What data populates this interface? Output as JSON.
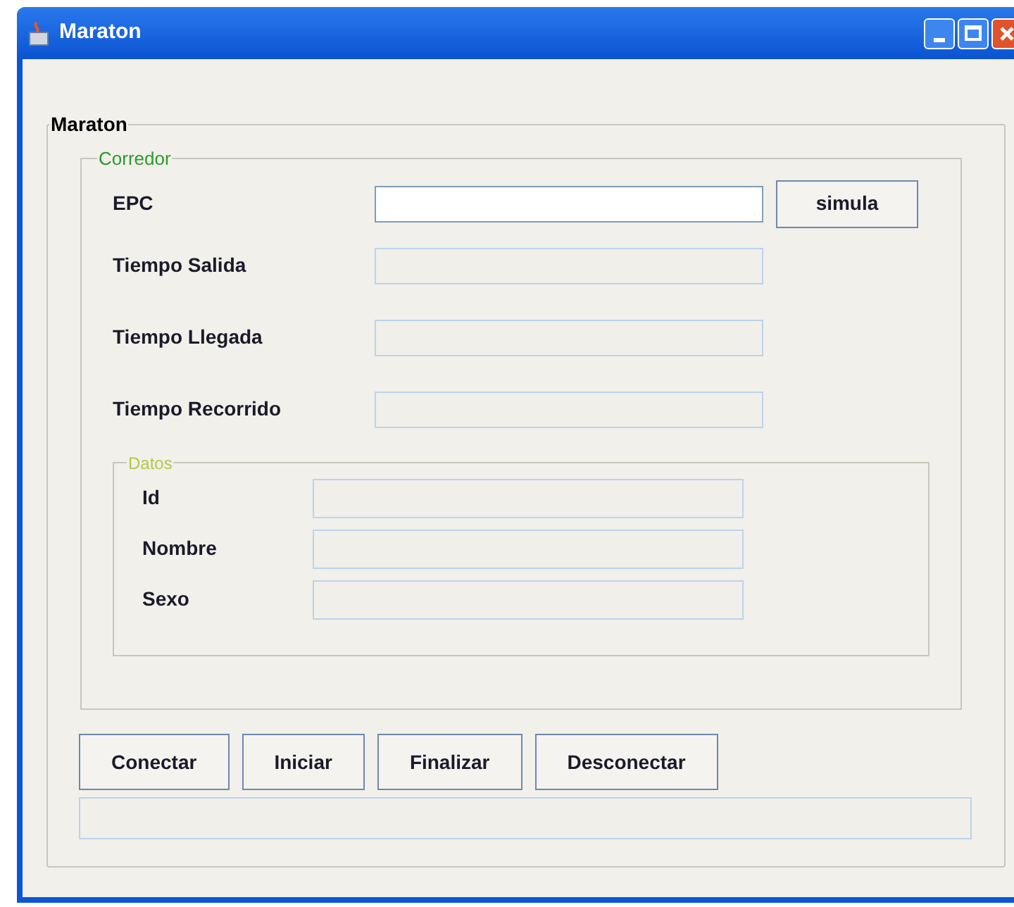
{
  "window": {
    "title": "Maraton"
  },
  "main_group": {
    "title": "Maraton"
  },
  "runner_group": {
    "title": "Corredor",
    "fields": [
      {
        "label": "EPC",
        "enabled": true
      },
      {
        "label": "Tiempo Salida",
        "enabled": false
      },
      {
        "label": "Tiempo Llegada",
        "enabled": false
      },
      {
        "label": "Tiempo Recorrido",
        "enabled": false
      }
    ],
    "simulate_button": "simula"
  },
  "data_group": {
    "title": "Datos",
    "fields": [
      {
        "label": "Id",
        "enabled": false
      },
      {
        "label": "Nombre",
        "enabled": false
      },
      {
        "label": "Sexo",
        "enabled": false
      }
    ]
  },
  "buttons": [
    "Conectar",
    "Iniciar",
    "Finalizar",
    "Desconectar"
  ],
  "status_field": {
    "enabled": false
  }
}
